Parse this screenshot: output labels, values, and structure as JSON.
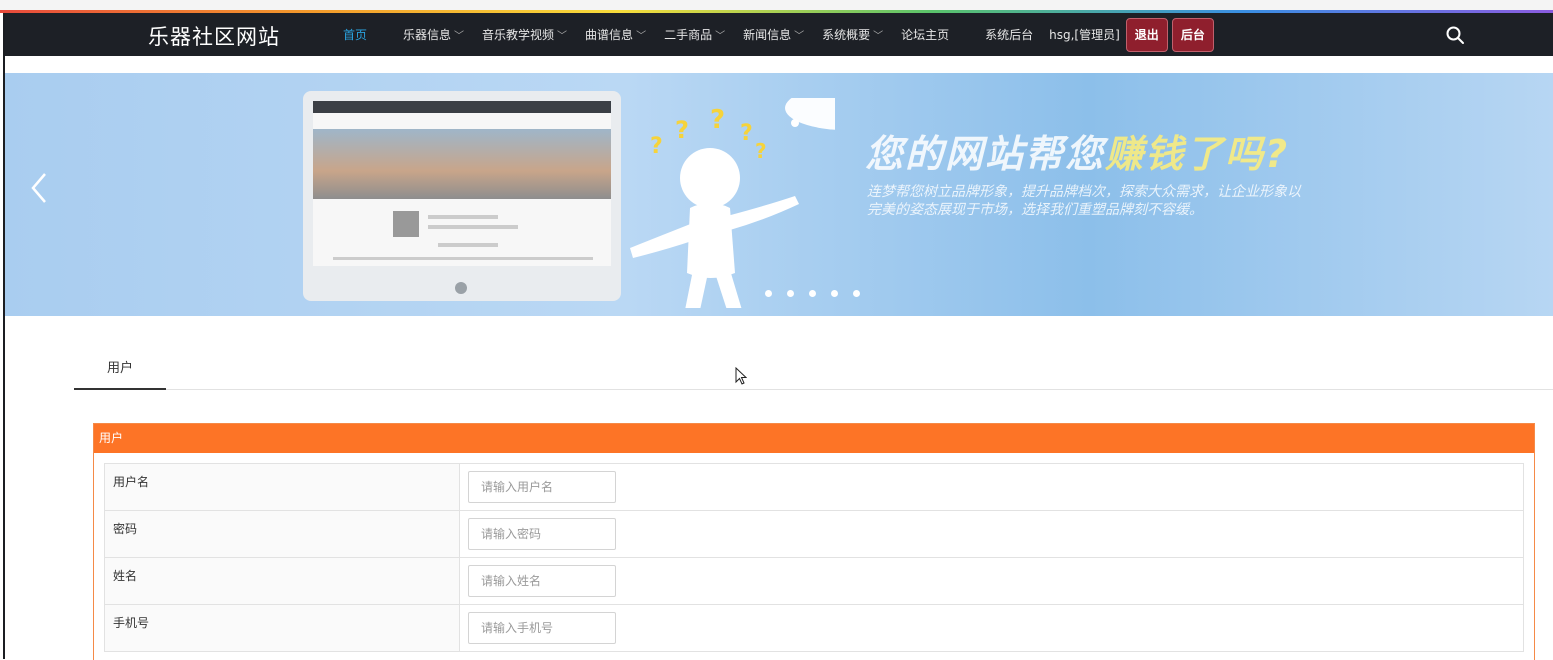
{
  "navbar": {
    "brand": "乐器社区网站",
    "items": [
      {
        "label": "首页",
        "active": true,
        "dropdown": false
      },
      {
        "label": "乐器信息",
        "dropdown": true
      },
      {
        "label": "音乐教学视频",
        "dropdown": true
      },
      {
        "label": "曲谱信息",
        "dropdown": true
      },
      {
        "label": "二手商品",
        "dropdown": true
      },
      {
        "label": "新闻信息",
        "dropdown": true
      },
      {
        "label": "系统概要",
        "dropdown": true
      },
      {
        "label": "论坛主页",
        "dropdown": false
      },
      {
        "label": "系统后台",
        "dropdown": false
      }
    ],
    "user": "hsg,[管理员]",
    "logout_label": "退出",
    "admin_label": "后台",
    "search_icon": "search-icon"
  },
  "banner": {
    "headline_main": "您的网站帮您",
    "headline_highlight": "赚钱了吗?",
    "subtext": "连梦帮您树立品牌形象，提升品牌档次，探索大众需求，让企业形象以完美的姿态展现于市场，选择我们重塑品牌刻不容缓。",
    "slide_count": 5,
    "colors": {
      "background": "#bad8f4",
      "highlight": "#ffee78"
    }
  },
  "tabs": [
    {
      "label": "用户",
      "active": true
    }
  ],
  "form": {
    "title": "用户",
    "header_color": "#fd7426",
    "fields": [
      {
        "label": "用户名",
        "placeholder": "请输入用户名",
        "value": ""
      },
      {
        "label": "密码",
        "placeholder": "请输入密码",
        "value": ""
      },
      {
        "label": "姓名",
        "placeholder": "请输入姓名",
        "value": ""
      },
      {
        "label": "手机号",
        "placeholder": "请输入手机号",
        "value": ""
      }
    ]
  }
}
